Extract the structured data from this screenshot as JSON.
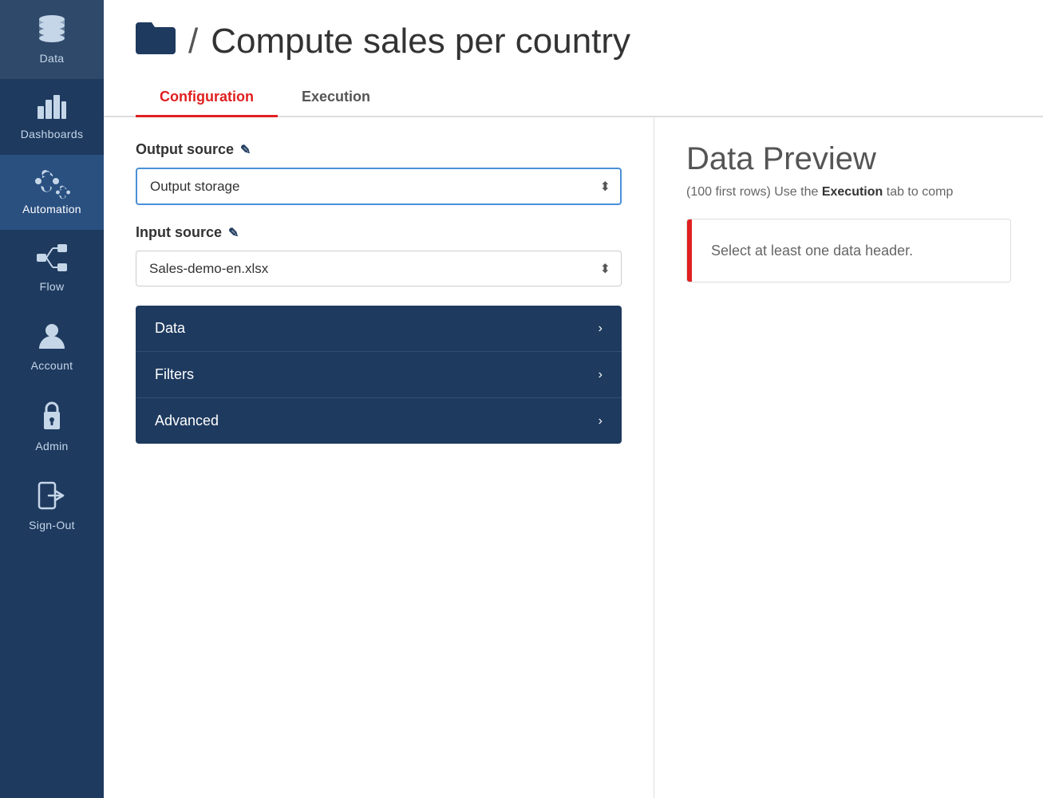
{
  "sidebar": {
    "items": [
      {
        "id": "data",
        "label": "Data",
        "icon": "data-icon"
      },
      {
        "id": "dashboards",
        "label": "Dashboards",
        "icon": "dashboards-icon"
      },
      {
        "id": "automation",
        "label": "Automation",
        "icon": "automation-icon",
        "active": true
      },
      {
        "id": "flow",
        "label": "Flow",
        "icon": "flow-icon"
      },
      {
        "id": "account",
        "label": "Account",
        "icon": "account-icon"
      },
      {
        "id": "admin",
        "label": "Admin",
        "icon": "admin-icon"
      },
      {
        "id": "signout",
        "label": "Sign-Out",
        "icon": "signout-icon"
      }
    ]
  },
  "header": {
    "folder_icon": "📁",
    "slash": "/",
    "title": "Compute sales per country"
  },
  "tabs": [
    {
      "id": "configuration",
      "label": "Configuration",
      "active": true
    },
    {
      "id": "execution",
      "label": "Execution",
      "active": false
    }
  ],
  "left_panel": {
    "output_source_label": "Output source",
    "output_source_options": [
      "Output storage"
    ],
    "output_source_selected": "Output storage",
    "input_source_label": "Input source",
    "input_source_options": [
      "Sales-demo-en.xlsx"
    ],
    "input_source_selected": "Sales-demo-en.xlsx",
    "accordion_items": [
      {
        "id": "data",
        "label": "Data"
      },
      {
        "id": "filters",
        "label": "Filters"
      },
      {
        "id": "advanced",
        "label": "Advanced"
      }
    ]
  },
  "right_panel": {
    "preview_title": "Data Preview",
    "preview_subtitle_prefix": "(100 first rows) Use the ",
    "preview_subtitle_bold": "Execution",
    "preview_subtitle_suffix": " tab to comp",
    "alert_message": "Select at least one data header."
  }
}
